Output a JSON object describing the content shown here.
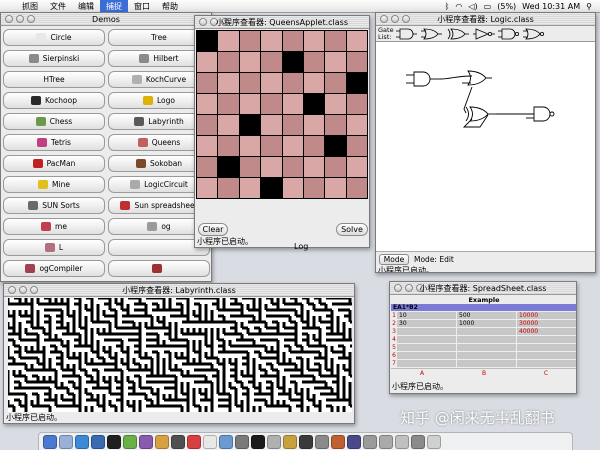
{
  "menubar": {
    "items": [
      {
        "label": "抓图",
        "active": false
      },
      {
        "label": "文件",
        "active": false
      },
      {
        "label": "编辑",
        "active": false
      },
      {
        "label": "捕捉",
        "active": true
      },
      {
        "label": "窗口",
        "active": false
      },
      {
        "label": "帮助",
        "active": false
      }
    ],
    "battery": "(5%)",
    "clock": "Wed 10:31 AM"
  },
  "demos_window": {
    "title": "Demos",
    "buttons": [
      {
        "label": "Circle",
        "icon": "circle-icon",
        "color": "#e8e8e8"
      },
      {
        "label": "Tree",
        "icon": "",
        "color": ""
      },
      {
        "label": "Sierpinski",
        "icon": "sierpinski-icon",
        "color": "#8a8a8a"
      },
      {
        "label": "Hilbert",
        "icon": "hilbert-icon",
        "color": "#8a8a8a"
      },
      {
        "label": "HTree",
        "icon": "",
        "color": ""
      },
      {
        "label": "KochCurve",
        "icon": "koch-icon",
        "color": "#b0b0b0"
      },
      {
        "label": "Kochoop",
        "icon": "kochoop-icon",
        "color": "#2a2a2a"
      },
      {
        "label": "Logo",
        "icon": "logo-icon",
        "color": "#e0b000"
      },
      {
        "label": "Chess",
        "icon": "chess-icon",
        "color": "#6a9a4a"
      },
      {
        "label": "Labyrinth",
        "icon": "labyrinth-icon",
        "color": "#5a5a5a"
      },
      {
        "label": "Tetris",
        "icon": "tetris-icon",
        "color": "#c04080"
      },
      {
        "label": "Queens",
        "icon": "queens-icon",
        "color": "#c06060"
      },
      {
        "label": "PacMan",
        "icon": "pacman-icon",
        "color": "#c02020"
      },
      {
        "label": "Sokoban",
        "icon": "sokoban-icon",
        "color": "#7a4a2a"
      },
      {
        "label": "Mine",
        "icon": "mine-icon",
        "color": "#e0c020"
      },
      {
        "label": "LogicCircuit",
        "icon": "logic-icon",
        "color": "#aaaaaa"
      },
      {
        "label": "SUN Sorts",
        "icon": "sorts-icon",
        "color": "#6a6a6a"
      },
      {
        "label": "Sun spreadsheet",
        "icon": "spreadsheet-icon",
        "color": "#c03030"
      },
      {
        "label": "me",
        "icon": "app-icon",
        "color": "#c04050"
      },
      {
        "label": "og",
        "icon": "app-icon",
        "color": "#9a9a9a"
      },
      {
        "label": "L",
        "icon": "app-icon",
        "color": "#b07080"
      },
      {
        "label": "",
        "icon": "",
        "color": ""
      },
      {
        "label": "ogCompiler",
        "icon": "app-icon",
        "color": "#a04050"
      },
      {
        "label": "",
        "icon": "app-icon",
        "color": "#a03030"
      }
    ]
  },
  "queens_window": {
    "title": "小程序查看器: QueensApplet.class",
    "queens": [
      {
        "row": 0,
        "col": 0
      },
      {
        "row": 1,
        "col": 4
      },
      {
        "row": 2,
        "col": 7
      },
      {
        "row": 3,
        "col": 5
      },
      {
        "row": 4,
        "col": 2
      },
      {
        "row": 5,
        "col": 6
      },
      {
        "row": 6,
        "col": 1
      },
      {
        "row": 7,
        "col": 3
      }
    ],
    "clear_label": "Clear",
    "solve_label": "Solve",
    "status": "小程序已启动。"
  },
  "logic_window": {
    "title": "小程序查看器: Logic.class",
    "gate_list_label": "Gate List:",
    "mode_label": "Mode",
    "mode_text": "Mode: Edit",
    "status": "小程序已启动。"
  },
  "log_window": {
    "title": "Log"
  },
  "labyrinth_window": {
    "title": "小程序查看器: Labyrinth.class",
    "status": "小程序已启动。"
  },
  "spreadsheet_window": {
    "title": "小程序查看器: SpreadSheet.class",
    "sheet_title": "Example",
    "formula": "EA1*B2",
    "rows": [
      {
        "n": "1",
        "a": "10",
        "b": "500",
        "c": "10000"
      },
      {
        "n": "2",
        "a": "30",
        "b": "1000",
        "c": "30000"
      },
      {
        "n": "3",
        "a": "",
        "b": "",
        "c": "40000"
      },
      {
        "n": "4",
        "a": "",
        "b": "",
        "c": ""
      },
      {
        "n": "5",
        "a": "",
        "b": "",
        "c": ""
      },
      {
        "n": "6",
        "a": "",
        "b": "",
        "c": ""
      },
      {
        "n": "7",
        "a": "",
        "b": "",
        "c": ""
      }
    ],
    "columns": [
      "A",
      "B",
      "C"
    ],
    "status": "小程序已启动。"
  },
  "watermark": "知乎 @闲来无事乱翻书",
  "dock": {
    "icons": [
      {
        "name": "finder-icon",
        "color": "#4a7ad0"
      },
      {
        "name": "mail-icon",
        "color": "#9ab0d8"
      },
      {
        "name": "safari-icon",
        "color": "#3a8ad8"
      },
      {
        "name": "ie-icon",
        "color": "#3a6ab0"
      },
      {
        "name": "qq-icon",
        "color": "#202020"
      },
      {
        "name": "chat-icon",
        "color": "#6ab04a"
      },
      {
        "name": "itunes-icon",
        "color": "#8a5ab0"
      },
      {
        "name": "photo-icon",
        "color": "#d8a040"
      },
      {
        "name": "movie-icon",
        "color": "#505050"
      },
      {
        "name": "app-icon",
        "color": "#d84040"
      },
      {
        "name": "ical-icon",
        "color": "#e8e8e8"
      },
      {
        "name": "preview-icon",
        "color": "#6a9ad0"
      },
      {
        "name": "prefs-icon",
        "color": "#7a7a7a"
      },
      {
        "name": "terminal-icon",
        "color": "#1a1a1a"
      },
      {
        "name": "app-icon",
        "color": "#b0b0b0"
      },
      {
        "name": "app-icon",
        "color": "#c8a040"
      },
      {
        "name": "app-icon",
        "color": "#3a3a3a"
      },
      {
        "name": "app-icon",
        "color": "#8a8a8a"
      },
      {
        "name": "java-icon",
        "color": "#c06030"
      },
      {
        "name": "app-icon",
        "color": "#4a4a8a"
      },
      {
        "name": "app-icon",
        "color": "#9a9a9a"
      },
      {
        "name": "app-icon",
        "color": "#aaaaaa"
      },
      {
        "name": "app-icon",
        "color": "#c0c0c0"
      },
      {
        "name": "app-icon",
        "color": "#8a8a8a"
      },
      {
        "name": "trash-icon",
        "color": "#d0d0d0"
      }
    ]
  }
}
